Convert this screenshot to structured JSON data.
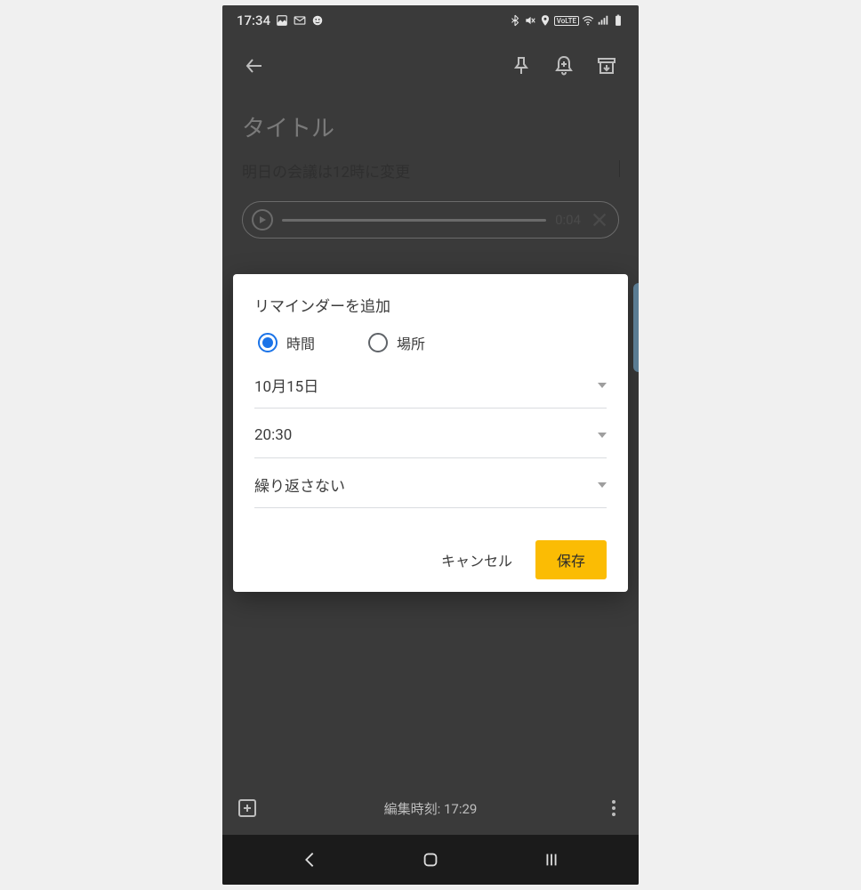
{
  "statusbar": {
    "time": "17:34"
  },
  "note": {
    "title_placeholder": "タイトル",
    "body": "明日の会議は12時に変更",
    "audio_duration": "0:04"
  },
  "bottombar": {
    "edited_label": "編集時刻: 17:29"
  },
  "dialog": {
    "title": "リマインダーを追加",
    "radio_time_label": "時間",
    "radio_place_label": "場所",
    "date_value": "10月15日",
    "time_value": "20:30",
    "repeat_value": "繰り返さない",
    "cancel_label": "キャンセル",
    "save_label": "保存"
  }
}
